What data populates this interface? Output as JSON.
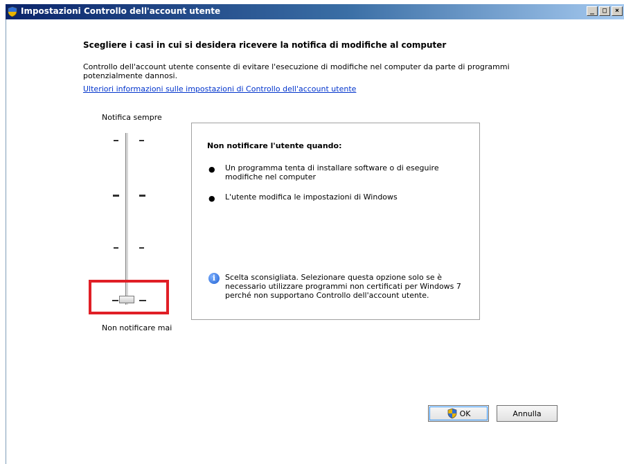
{
  "window": {
    "title": "Impostazioni Controllo dell'account utente",
    "controls": {
      "minimize": "_",
      "maximize": "□",
      "close": "×"
    }
  },
  "content": {
    "heading": "Scegliere i casi in cui si desidera ricevere la notifica di modifiche al computer",
    "description": "Controllo dell'account utente consente di evitare l'esecuzione di modifiche nel computer da parte di programmi potenzialmente dannosi.",
    "link": "Ulteriori informazioni sulle impostazioni di Controllo dell'account utente"
  },
  "slider": {
    "top_label": "Notifica sempre",
    "bottom_label": "Non notificare mai",
    "levels": 4,
    "selected_level": 4
  },
  "info_box": {
    "title": "Non notificare l'utente quando:",
    "bullets": [
      "Un programma tenta di installare software o di eseguire modifiche nel computer",
      "L'utente modifica le impostazioni di Windows"
    ],
    "note": "Scelta sconsigliata. Selezionare questa opzione solo se è necessario utilizzare programmi non certificati per Windows 7 perché non supportano Controllo dell'account utente."
  },
  "buttons": {
    "ok": "OK",
    "cancel": "Annulla"
  },
  "icons": {
    "title": "shield-icon",
    "note": "info-icon",
    "ok_button": "shield-icon"
  },
  "colors": {
    "titlebar_start": "#0a246a",
    "link": "#0033cc",
    "highlight": "#e01f26"
  }
}
